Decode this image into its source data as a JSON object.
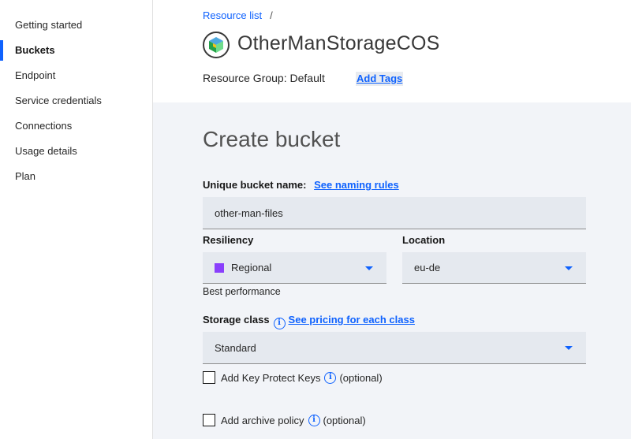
{
  "sidebar": {
    "items": [
      {
        "label": "Getting started"
      },
      {
        "label": "Buckets"
      },
      {
        "label": "Endpoint"
      },
      {
        "label": "Service credentials"
      },
      {
        "label": "Connections"
      },
      {
        "label": "Usage details"
      },
      {
        "label": "Plan"
      }
    ],
    "active": "Buckets"
  },
  "header": {
    "breadcrumb": "Resource list",
    "breadcrumb_separator": "/",
    "title": "OtherManStorageCOS",
    "resource_group_label": "Resource Group:",
    "resource_group_value": "Default",
    "add_tags": "Add Tags"
  },
  "form": {
    "title": "Create bucket",
    "bucket_name": {
      "label": "Unique bucket name:",
      "link": "See naming rules",
      "value": "other-man-files"
    },
    "resiliency": {
      "label": "Resiliency",
      "value": "Regional",
      "swatch_color": "#8a3ffc",
      "helper": "Best performance"
    },
    "location": {
      "label": "Location",
      "value": "eu-de"
    },
    "storage_class": {
      "label": "Storage class",
      "link": "See pricing for each class",
      "value": "Standard"
    },
    "key_protect": {
      "label": "Add Key Protect Keys",
      "optional": "(optional)"
    },
    "archive_policy": {
      "label": "Add archive policy",
      "optional": "(optional)"
    }
  },
  "colors": {
    "accent": "#0f62fe",
    "panel_bg": "#f2f4f8",
    "field_bg": "#e5e9ef"
  }
}
